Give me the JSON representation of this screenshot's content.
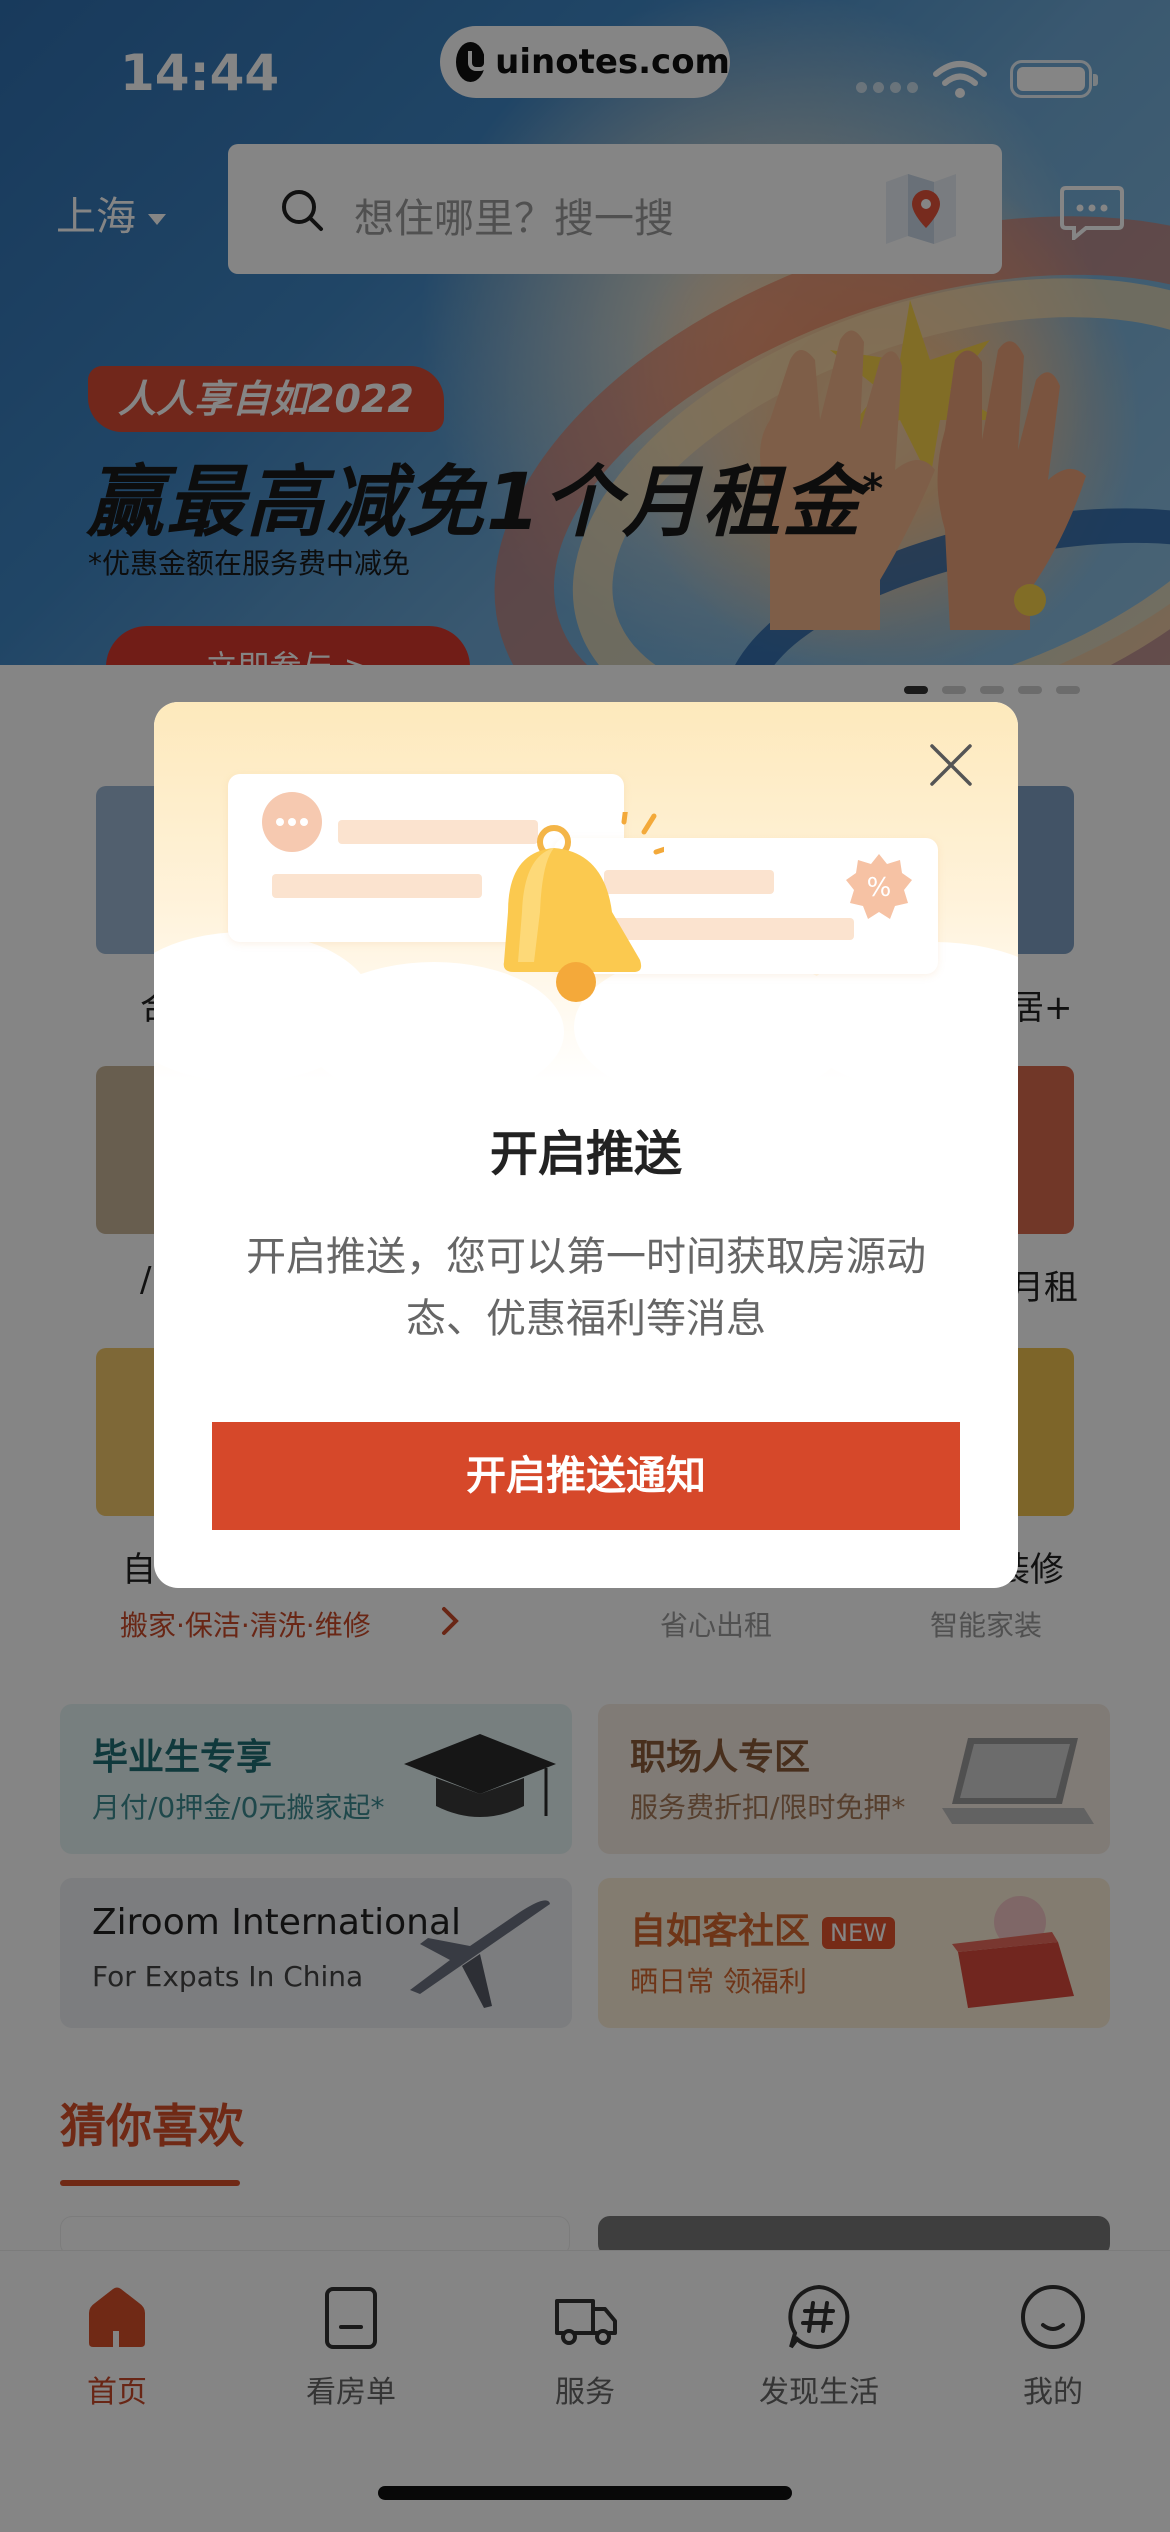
{
  "status_bar": {
    "time": "14:44",
    "url": "uinotes.com"
  },
  "header": {
    "city": "上海",
    "search_placeholder": "想住哪里？搜一搜"
  },
  "banner": {
    "pill": "人人享自如2022",
    "headline": "赢最高减免1个月租金",
    "headline_mark": "*",
    "note": "*优惠金额在服务费中减免",
    "cta": "立即参与 >",
    "dots": 5,
    "active_dot": 0
  },
  "grid": {
    "partial_labels": [
      "合",
      "居+",
      "/",
      "月租",
      "自",
      "装修"
    ],
    "sub_labels": [
      "搬家·保洁·清洗·维修",
      "省心出租",
      "智能家装"
    ]
  },
  "promos": [
    {
      "title": "毕业生专享",
      "subtitle": "月付/0押金/0元搬家起*"
    },
    {
      "title": "职场人专区",
      "subtitle": "服务费折扣/限时免押*"
    },
    {
      "title": "Ziroom International",
      "subtitle": "For Expats In China"
    },
    {
      "title": "自如客社区",
      "badge": "NEW",
      "subtitle": "晒日常 领福利"
    }
  ],
  "section": {
    "title": "猜你喜欢"
  },
  "tabbar": {
    "tabs": [
      {
        "label": "首页",
        "icon": "home-icon",
        "active": true
      },
      {
        "label": "看房单",
        "icon": "clipboard-icon",
        "active": false
      },
      {
        "label": "服务",
        "icon": "truck-icon",
        "active": false
      },
      {
        "label": "发现生活",
        "icon": "hashtag-icon",
        "active": false
      },
      {
        "label": "我的",
        "icon": "smile-icon",
        "active": false
      }
    ]
  },
  "modal": {
    "title": "开启推送",
    "description": "开启推送，您可以第一时间获取房源动态、优惠福利等消息",
    "button": "开启推送通知",
    "hero_badge": "%"
  },
  "colors": {
    "accent": "#d6482a",
    "orange_text": "#c94a2a",
    "overlay": "rgba(0,0,0,0.48)"
  }
}
